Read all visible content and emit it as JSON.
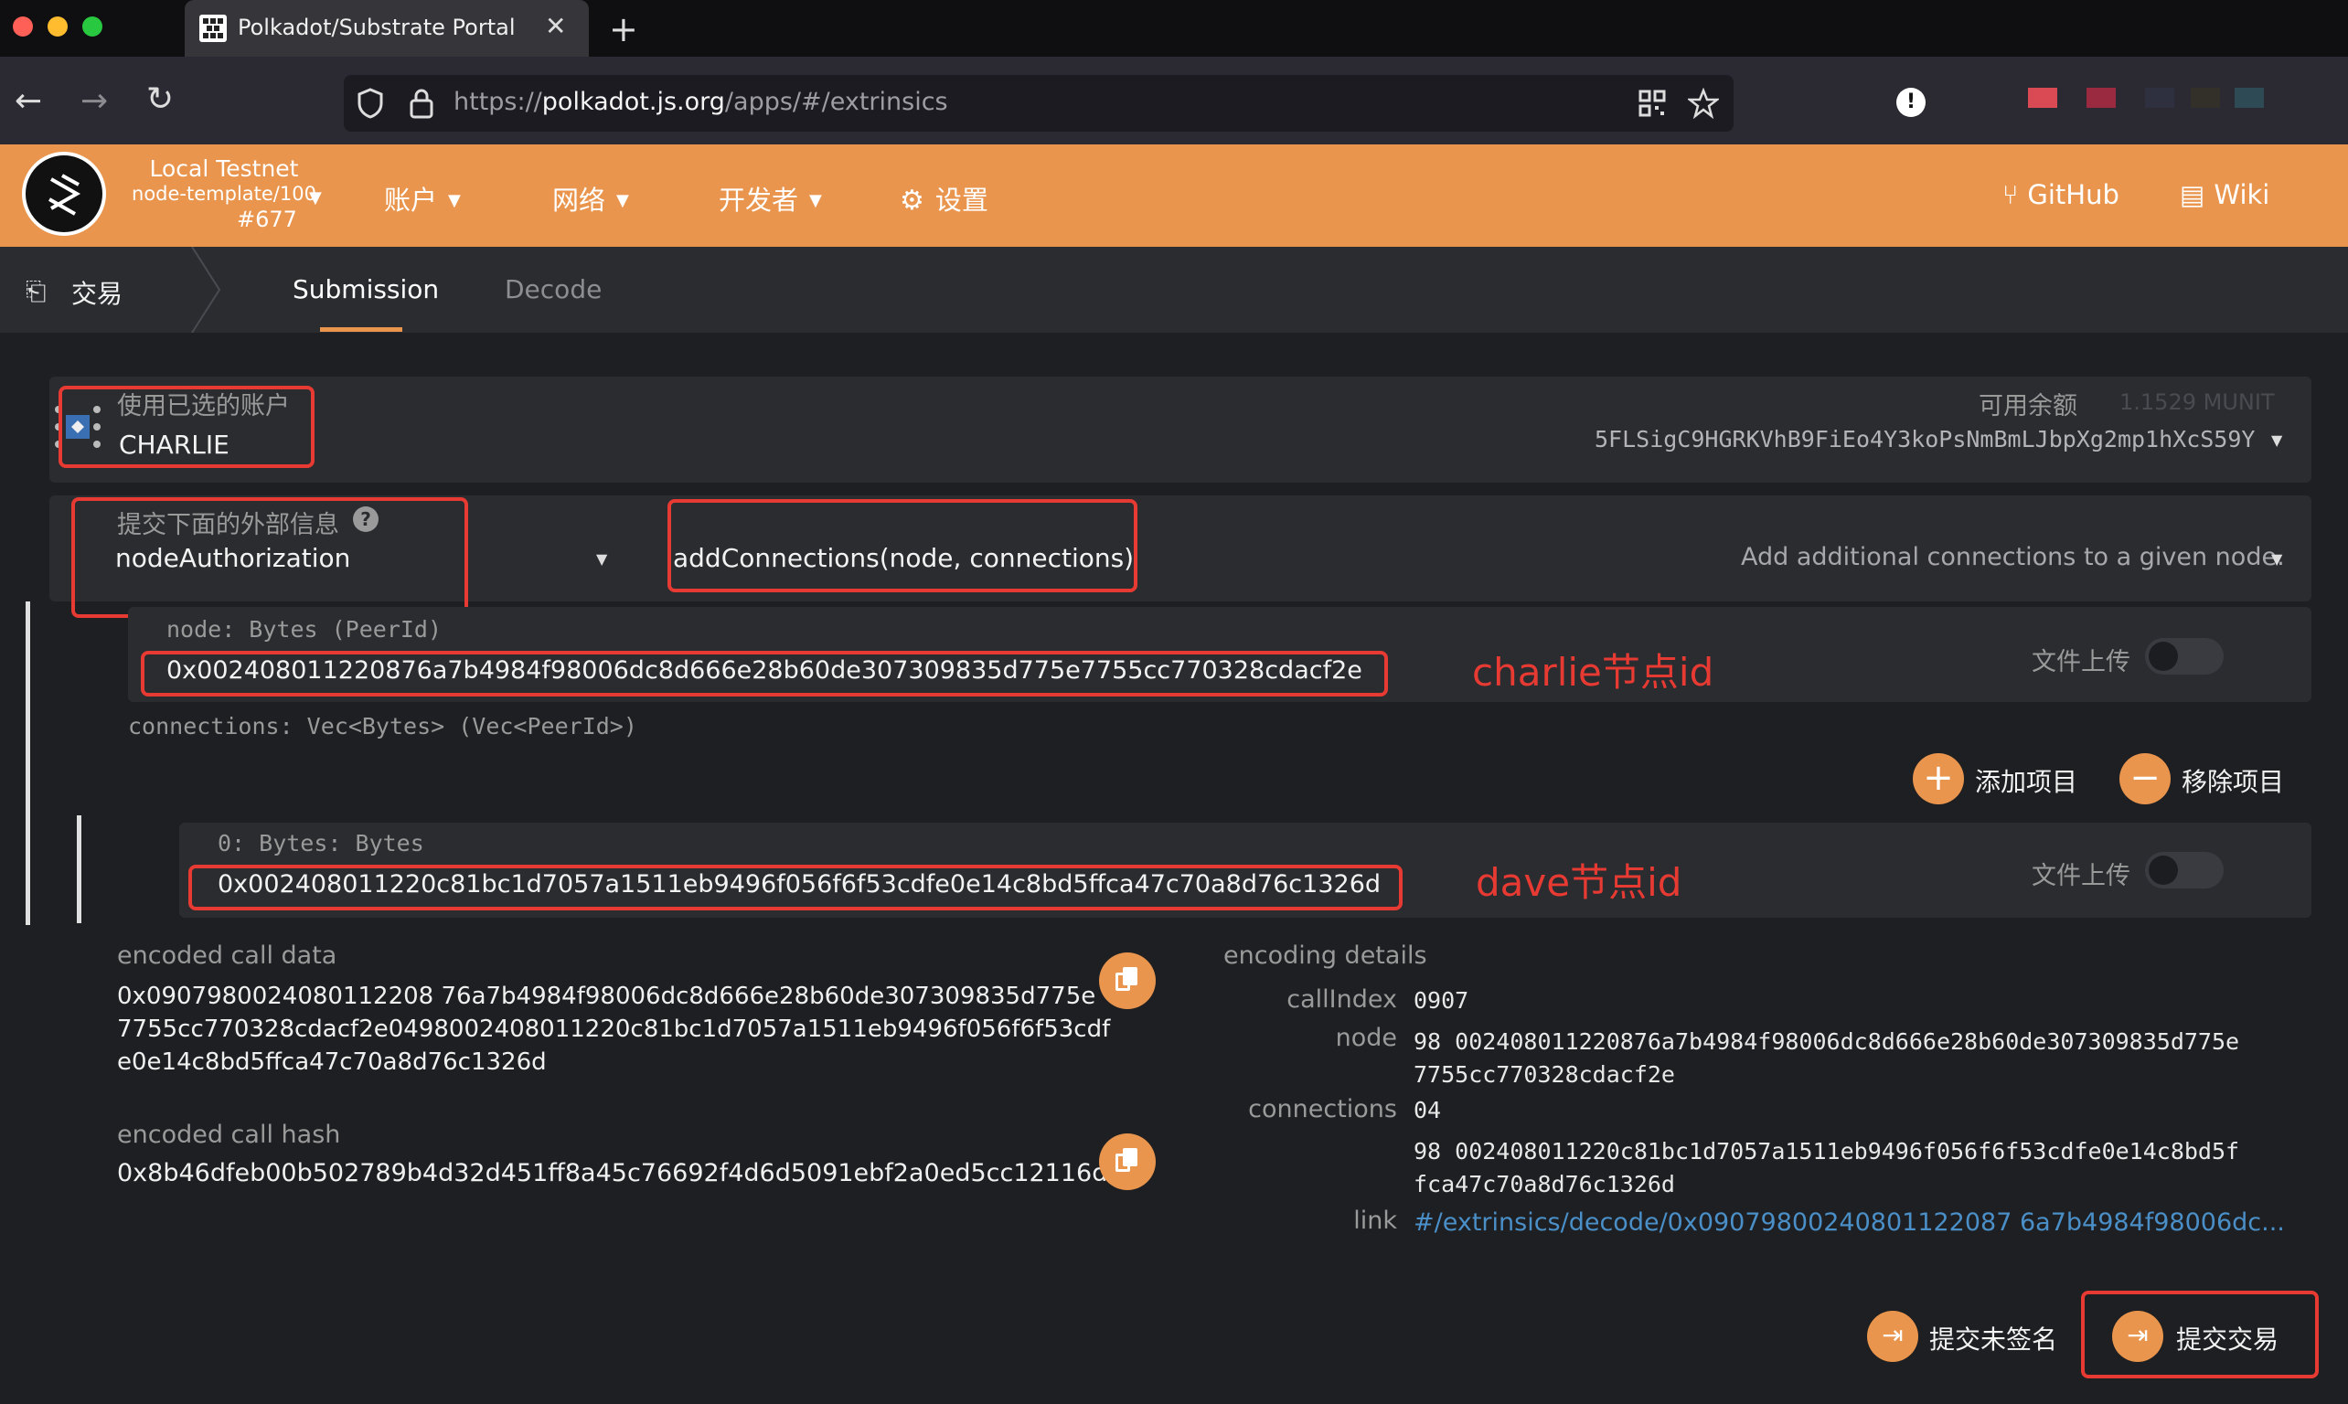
{
  "browser": {
    "tab_title": "Polkadot/Substrate Portal",
    "tab_close": "✕",
    "new_tab": "+",
    "url_prefix": "https://",
    "url_host": "polkadot.js.org",
    "url_path": "/apps/#/extrinsics",
    "back_icon": "←",
    "forward_icon": "→",
    "reload_icon": "↻"
  },
  "app": {
    "chain_name": "Local Testnet",
    "chain_runtime": "node-template/100",
    "chain_block": "#677",
    "menu": [
      {
        "label": "账户"
      },
      {
        "label": "网络"
      },
      {
        "label": "开发者"
      },
      {
        "label": "设置"
      }
    ],
    "github": "GitHub",
    "wiki": "Wiki",
    "accent_color": "#e9954d"
  },
  "subnav": {
    "section": "交易",
    "tabs": [
      "Submission",
      "Decode"
    ]
  },
  "account": {
    "label": "使用已选的账户",
    "name": "CHARLIE",
    "balance_label": "可用余额",
    "balance_value": "1.1529 MUNIT",
    "address": "5FLSigC9HGRKVhB9FiEo4Y3koPsNmBmLJbpXg2mp1hXcS59Y"
  },
  "extrinsic": {
    "label": "提交下面的外部信息",
    "module": "nodeAuthorization",
    "method": "addConnections(node, connections)",
    "method_desc": "Add additional connections to a given node."
  },
  "params": {
    "node_label": "node: Bytes (PeerId)",
    "node_value": "0x002408011220876a7b4984f98006dc8d666e28b60de307309835d775e7755cc770328cdacf2e",
    "node_annotation": "charlie节点id",
    "file_upload": "文件上传",
    "connections_label": "connections: Vec<Bytes> (Vec<PeerId>)",
    "add_item": "添加项目",
    "remove_item": "移除项目",
    "item0_label": "0: Bytes: Bytes",
    "item0_value": "0x002408011220c81bc1d7057a1511eb9496f056f6f53cdfe0e14c8bd5ffca47c70a8d76c1326d",
    "item0_annotation": "dave节点id"
  },
  "encoded": {
    "call_data_label": "encoded call data",
    "call_data_lines": [
      "0x0907980024080112208 76a7b4984f98006dc8d666e28b60de307309835d775e",
      "7755cc770328cdacf2e0498002408011220c81bc1d7057a1511eb9496f056f6f53cdf",
      "e0e14c8bd5ffca47c70a8d76c1326d"
    ],
    "call_hash_label": "encoded call hash",
    "call_hash": "0x8b46dfeb00b502789b4d32d451ff8a45c76692f4d6d5091ebf2a0ed5cc12116d"
  },
  "details": {
    "title": "encoding details",
    "callindex_label": "callIndex",
    "callindex": "0907",
    "node_label": "node",
    "node_line1": "98 002408011220876a7b4984f98006dc8d666e28b60de307309835d775e",
    "node_line2": "7755cc770328cdacf2e",
    "connections_label": "connections",
    "connections_count": "04",
    "conn_line1": "98 002408011220c81bc1d7057a1511eb9496f056f6f53cdfe0e14c8bd5f",
    "conn_line2": "fca47c70a8d76c1326d",
    "link_label": "link",
    "link_value": "#/extrinsics/decode/0x09079800240801122087 6a7b4984f98006dc..."
  },
  "actions": {
    "submit_unsigned": "提交未签名",
    "submit": "提交交易"
  }
}
